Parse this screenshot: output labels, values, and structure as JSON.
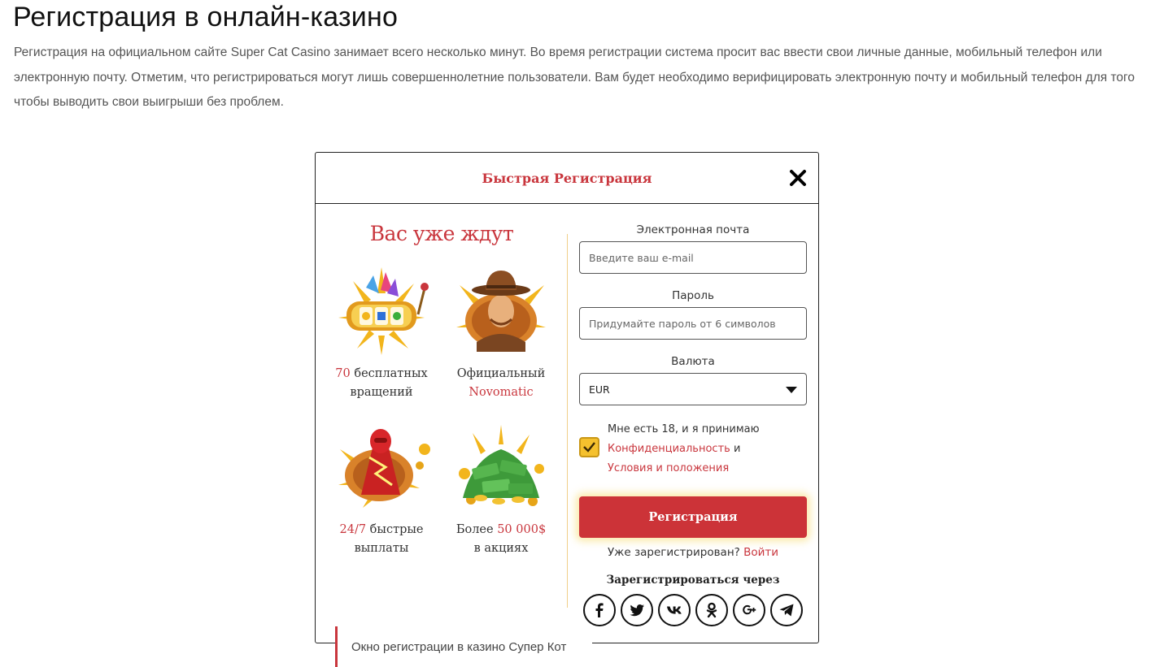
{
  "article": {
    "title": "Регистрация в онлайн-казино",
    "intro": "Регистрация на официальном сайте Super Cat Casino занимает всего несколько минут. Во время регистрации система просит вас ввести свои личные данные, мобильный телефон или электронную почту. Отметим, что регистрироваться могут лишь совершеннолетние пользователи. Вам будет необходимо верифицировать электронную почту и мобильный телефон для того чтобы выводить свои выигрыши без проблем.",
    "caption": "Окно регистрации в казино Супер Кот"
  },
  "modal": {
    "title": "Быстрая Регистрация",
    "close_icon": "close-icon",
    "promo": {
      "heading": "Вас уже ждут",
      "features": [
        {
          "icon": "slot-machine-icon",
          "highlight": "70",
          "text": " бесплатных вращений",
          "highlight_first": true
        },
        {
          "icon": "adventurer-icon",
          "text": "Официальный ",
          "highlight": "Novomatic",
          "highlight_first": false
        },
        {
          "icon": "lightning-hero-icon",
          "highlight": "24/7",
          "text": " быстрые выплаты",
          "highlight_first": true
        },
        {
          "icon": "money-pile-icon",
          "prefix": "Более ",
          "highlight": "50 000$",
          "text": " в акциях",
          "highlight_first": false
        }
      ]
    },
    "form": {
      "email_label": "Электронная почта",
      "email_placeholder": "Введите ваш e-mail",
      "password_label": "Пароль",
      "password_placeholder": "Придумайте пароль от 6 символов",
      "currency_label": "Валюта",
      "currency_value": "EUR",
      "consent_checked": true,
      "consent_prefix": "Мне есть 18, и я принимаю",
      "privacy_link": "Конфиденциальность",
      "consent_and": " и",
      "terms_link": "Условия и положения",
      "submit_label": "Регистрация",
      "already_registered": "Уже зарегистрирован?",
      "login_link": "Войти",
      "social_label": "Зарегистрироваться через",
      "social": [
        "facebook-icon",
        "twitter-icon",
        "vk-icon",
        "odnoklassniki-icon",
        "google-plus-icon",
        "telegram-icon"
      ]
    },
    "colors": {
      "accent": "#c9363d",
      "checkbox": "#f5c12e",
      "button": "#cc3338"
    }
  }
}
